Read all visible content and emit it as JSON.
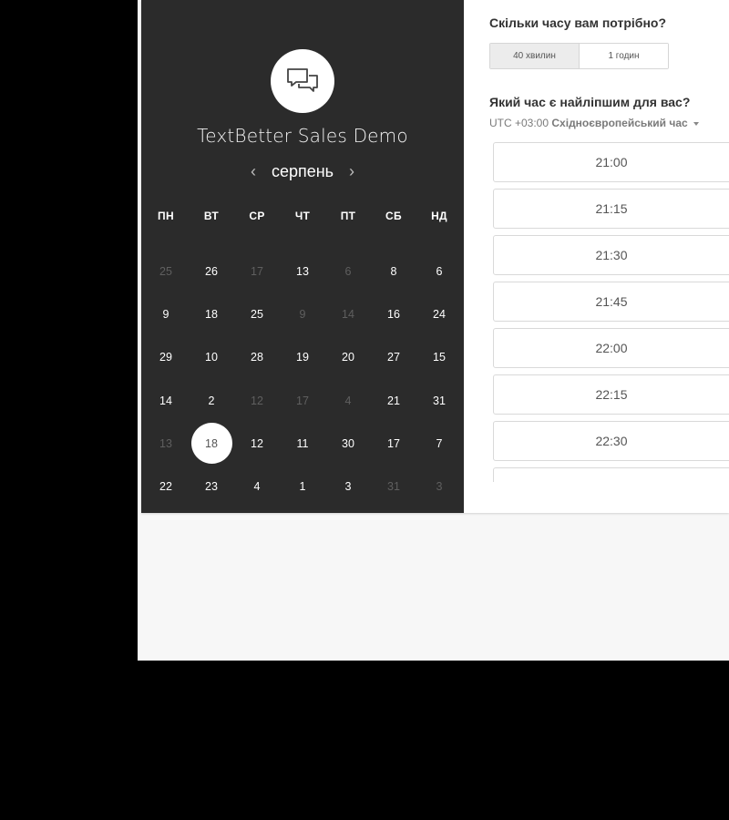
{
  "brand": {
    "title": "TextBetter Sales Demo",
    "logo_icon": "chat-bubbles-icon"
  },
  "calendar": {
    "month": "серпень",
    "prev_icon": "chevron-left-icon",
    "next_icon": "chevron-right-icon",
    "weekdays": [
      "ПН",
      "ВТ",
      "СР",
      "ЧТ",
      "ПТ",
      "СБ",
      "НД"
    ],
    "weeks": [
      [
        {
          "d": "25",
          "dim": true
        },
        {
          "d": "26"
        },
        {
          "d": "17",
          "dim": true
        },
        {
          "d": "13"
        },
        {
          "d": "6",
          "dim": true
        },
        {
          "d": "8"
        },
        {
          "d": "6"
        }
      ],
      [
        {
          "d": "9"
        },
        {
          "d": "18"
        },
        {
          "d": "25"
        },
        {
          "d": "9",
          "dim": true
        },
        {
          "d": "14",
          "dim": true
        },
        {
          "d": "16"
        },
        {
          "d": "24"
        }
      ],
      [
        {
          "d": "29"
        },
        {
          "d": "10"
        },
        {
          "d": "28"
        },
        {
          "d": "19"
        },
        {
          "d": "20"
        },
        {
          "d": "27"
        },
        {
          "d": "15"
        }
      ],
      [
        {
          "d": "14"
        },
        {
          "d": "2"
        },
        {
          "d": "12",
          "dim": true
        },
        {
          "d": "17",
          "dim": true
        },
        {
          "d": "4",
          "dim": true
        },
        {
          "d": "21"
        },
        {
          "d": "31"
        }
      ],
      [
        {
          "d": "13",
          "dim": true
        },
        {
          "d": "18",
          "selected": true
        },
        {
          "d": "12"
        },
        {
          "d": "11"
        },
        {
          "d": "30"
        },
        {
          "d": "17"
        },
        {
          "d": "7"
        }
      ],
      [
        {
          "d": "22"
        },
        {
          "d": "23"
        },
        {
          "d": "4"
        },
        {
          "d": "1"
        },
        {
          "d": "3"
        },
        {
          "d": "31",
          "dim": true
        },
        {
          "d": "3",
          "dim": true
        }
      ]
    ]
  },
  "duration": {
    "question": "Скільки часу вам потрібно?",
    "options": [
      {
        "label": "40 хвилин",
        "selected": true
      },
      {
        "label": "1 годин",
        "selected": false
      }
    ]
  },
  "time": {
    "question": "Який час є найліпшим для вас?",
    "timezone_offset": "UTC +03:00",
    "timezone_name": "Східноєвропейський час",
    "slots": [
      "21:00",
      "21:15",
      "21:30",
      "21:45",
      "22:00",
      "22:15",
      "22:30",
      ""
    ]
  }
}
